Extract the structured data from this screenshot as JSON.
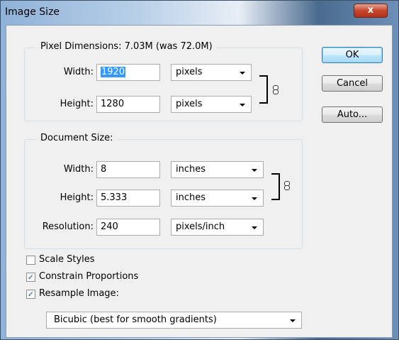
{
  "window": {
    "title": "Image Size",
    "close_label": "x"
  },
  "pixel_dimensions": {
    "legend": "Pixel Dimensions:  7.03M (was 72.0M)",
    "width_label": "Width:",
    "width_value": "1920",
    "width_unit": "pixels",
    "height_label": "Height:",
    "height_value": "1280",
    "height_unit": "pixels"
  },
  "document_size": {
    "legend": "Document Size:",
    "width_label": "Width:",
    "width_value": "8",
    "width_unit": "inches",
    "height_label": "Height:",
    "height_value": "5.333",
    "height_unit": "inches",
    "resolution_label": "Resolution:",
    "resolution_value": "240",
    "resolution_unit": "pixels/inch"
  },
  "options": {
    "scale_styles": {
      "label": "Scale Styles",
      "checked": false
    },
    "constrain_proportions": {
      "label": "Constrain Proportions",
      "checked": true
    },
    "resample_image": {
      "label": "Resample Image:",
      "checked": true
    }
  },
  "resample_method": "Bicubic (best for smooth gradients)",
  "buttons": {
    "ok": "OK",
    "cancel": "Cancel",
    "auto": "Auto..."
  },
  "checkmark": "✓"
}
